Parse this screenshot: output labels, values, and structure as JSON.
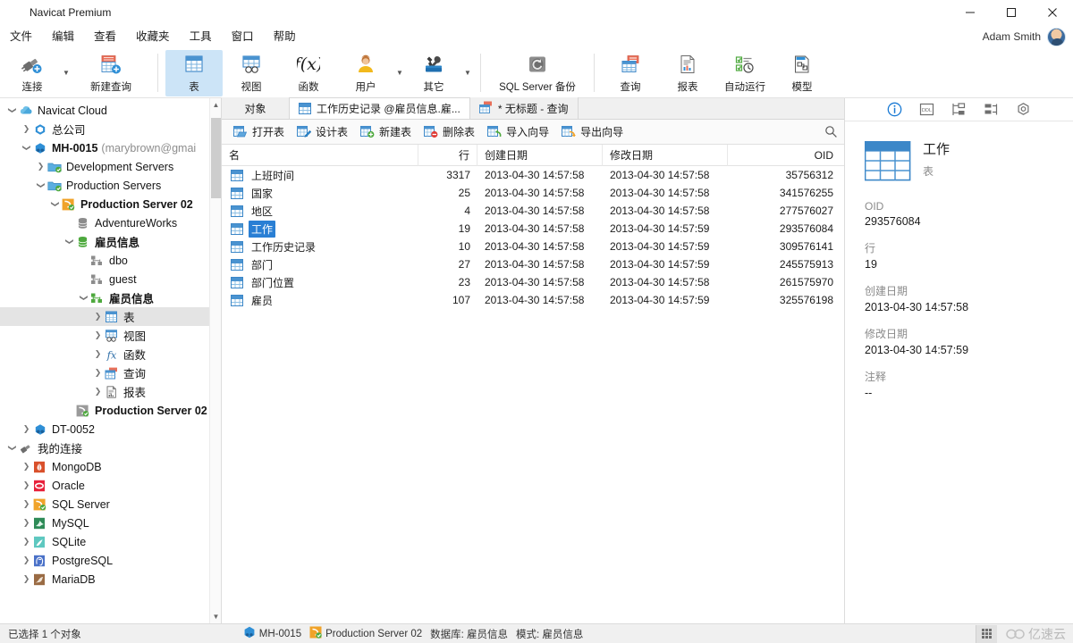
{
  "window": {
    "title": "Navicat Premium",
    "minimize": "—",
    "maximize": "□",
    "close": "✕"
  },
  "menu": {
    "items": [
      "文件",
      "编辑",
      "查看",
      "收藏夹",
      "工具",
      "窗口",
      "帮助"
    ],
    "user": "Adam Smith"
  },
  "toolbar": {
    "groups": [
      {
        "buttons": [
          {
            "label": "连接",
            "icon": "connection-icon",
            "caret": true,
            "selected": false
          },
          {
            "label": "新建查询",
            "icon": "new-query-icon",
            "caret": false,
            "selected": false
          }
        ]
      },
      {
        "buttons": [
          {
            "label": "表",
            "icon": "table-icon",
            "caret": false,
            "selected": true
          },
          {
            "label": "视图",
            "icon": "view-icon",
            "caret": false,
            "selected": false
          },
          {
            "label": "函数",
            "icon": "function-icon",
            "caret": false,
            "selected": false
          },
          {
            "label": "用户",
            "icon": "user-icon",
            "caret": true,
            "selected": false
          },
          {
            "label": "其它",
            "icon": "others-icon",
            "caret": true,
            "selected": false
          }
        ]
      },
      {
        "buttons": [
          {
            "label": "SQL Server 备份",
            "icon": "backup-icon",
            "caret": false,
            "selected": false
          }
        ]
      },
      {
        "buttons": [
          {
            "label": "查询",
            "icon": "query-icon",
            "caret": false,
            "selected": false
          },
          {
            "label": "报表",
            "icon": "report-icon",
            "caret": false,
            "selected": false
          },
          {
            "label": "自动运行",
            "icon": "automation-icon",
            "caret": false,
            "selected": false
          },
          {
            "label": "模型",
            "icon": "model-icon",
            "caret": false,
            "selected": false
          }
        ]
      }
    ]
  },
  "sidebar": {
    "nodes": [
      {
        "label": "Navicat Cloud",
        "sub": "",
        "indent": 0,
        "chev": "down",
        "icon": "cloud-icon",
        "bold": false,
        "selected": false
      },
      {
        "label": "总公司",
        "sub": "",
        "indent": 1,
        "chev": "right",
        "icon": "org-icon",
        "bold": false,
        "selected": false
      },
      {
        "label": "MH-0015",
        "sub": "(marybrown@gmai",
        "indent": 1,
        "chev": "down",
        "icon": "project-icon",
        "bold": true,
        "selected": false
      },
      {
        "label": "Development Servers",
        "sub": "",
        "indent": 2,
        "chev": "right",
        "icon": "folder-icon",
        "bold": false,
        "selected": false
      },
      {
        "label": "Production Servers",
        "sub": "",
        "indent": 2,
        "chev": "down",
        "icon": "folder-icon",
        "bold": false,
        "selected": false
      },
      {
        "label": "Production Server 02",
        "sub": "",
        "indent": 3,
        "chev": "down",
        "icon": "sqlserver-icon",
        "bold": true,
        "selected": false
      },
      {
        "label": "AdventureWorks",
        "sub": "",
        "indent": 4,
        "chev": "none",
        "icon": "db-gray-icon",
        "bold": false,
        "selected": false
      },
      {
        "label": "雇员信息",
        "sub": "",
        "indent": 4,
        "chev": "down",
        "icon": "db-green-icon",
        "bold": true,
        "selected": false
      },
      {
        "label": "dbo",
        "sub": "",
        "indent": 5,
        "chev": "none",
        "icon": "schema-gray-icon",
        "bold": false,
        "selected": false
      },
      {
        "label": "guest",
        "sub": "",
        "indent": 5,
        "chev": "none",
        "icon": "schema-gray-icon",
        "bold": false,
        "selected": false
      },
      {
        "label": "雇员信息",
        "sub": "",
        "indent": 5,
        "chev": "down",
        "icon": "schema-green-icon",
        "bold": true,
        "selected": false
      },
      {
        "label": "表",
        "sub": "",
        "indent": 6,
        "chev": "right",
        "icon": "table-icon",
        "bold": false,
        "selected": true
      },
      {
        "label": "视图",
        "sub": "",
        "indent": 6,
        "chev": "right",
        "icon": "view-icon",
        "bold": false,
        "selected": false
      },
      {
        "label": "函数",
        "sub": "",
        "indent": 6,
        "chev": "right",
        "icon": "function-icon",
        "bold": false,
        "selected": false
      },
      {
        "label": "查询",
        "sub": "",
        "indent": 6,
        "chev": "right",
        "icon": "query-icon",
        "bold": false,
        "selected": false
      },
      {
        "label": "报表",
        "sub": "",
        "indent": 6,
        "chev": "right",
        "icon": "report-icon",
        "bold": false,
        "selected": false
      },
      {
        "label": "Production Server 02",
        "sub": "",
        "indent": 4,
        "chev": "none",
        "icon": "sqlserver-gray-icon",
        "bold": true,
        "selected": false
      },
      {
        "label": "DT-0052",
        "sub": "",
        "indent": 1,
        "chev": "right",
        "icon": "project-icon",
        "bold": false,
        "selected": false
      },
      {
        "label": "我的连接",
        "sub": "",
        "indent": 0,
        "chev": "down",
        "icon": "connection-icon",
        "bold": false,
        "selected": false
      },
      {
        "label": "MongoDB",
        "sub": "",
        "indent": 1,
        "chev": "right",
        "icon": "mongodb-icon",
        "bold": false,
        "selected": false
      },
      {
        "label": "Oracle",
        "sub": "",
        "indent": 1,
        "chev": "right",
        "icon": "oracle-icon",
        "bold": false,
        "selected": false
      },
      {
        "label": "SQL Server",
        "sub": "",
        "indent": 1,
        "chev": "right",
        "icon": "sqlserver-icon",
        "bold": false,
        "selected": false
      },
      {
        "label": "MySQL",
        "sub": "",
        "indent": 1,
        "chev": "right",
        "icon": "mysql-icon",
        "bold": false,
        "selected": false
      },
      {
        "label": "SQLite",
        "sub": "",
        "indent": 1,
        "chev": "right",
        "icon": "sqlite-icon",
        "bold": false,
        "selected": false
      },
      {
        "label": "PostgreSQL",
        "sub": "",
        "indent": 1,
        "chev": "right",
        "icon": "postgresql-icon",
        "bold": false,
        "selected": false
      },
      {
        "label": "MariaDB",
        "sub": "",
        "indent": 1,
        "chev": "right",
        "icon": "mariadb-icon",
        "bold": false,
        "selected": false
      }
    ]
  },
  "tabs": {
    "object_tab": "对象",
    "items": [
      {
        "label": "工作历史记录 @雇员信息.雇...",
        "icon": "table-icon",
        "active": true
      },
      {
        "label": "* 无标题 - 查询",
        "icon": "query-icon",
        "active": false
      }
    ]
  },
  "object_toolbar": {
    "buttons": [
      {
        "label": "打开表",
        "icon": "open-table-icon"
      },
      {
        "label": "设计表",
        "icon": "design-table-icon"
      },
      {
        "label": "新建表",
        "icon": "new-table-icon"
      },
      {
        "label": "删除表",
        "icon": "delete-table-icon"
      },
      {
        "label": "导入向导",
        "icon": "import-wizard-icon"
      },
      {
        "label": "导出向导",
        "icon": "export-wizard-icon"
      }
    ],
    "search_icon": "search-icon"
  },
  "grid": {
    "columns": [
      "名",
      "行",
      "创建日期",
      "修改日期",
      "OID"
    ],
    "rows": [
      {
        "name": "上班时间",
        "rows": "3317",
        "created": "2013-04-30 14:57:58",
        "modified": "2013-04-30 14:57:58",
        "oid": "35756312",
        "selected": false
      },
      {
        "name": "国家",
        "rows": "25",
        "created": "2013-04-30 14:57:58",
        "modified": "2013-04-30 14:57:58",
        "oid": "341576255",
        "selected": false
      },
      {
        "name": "地区",
        "rows": "4",
        "created": "2013-04-30 14:57:58",
        "modified": "2013-04-30 14:57:58",
        "oid": "277576027",
        "selected": false
      },
      {
        "name": "工作",
        "rows": "19",
        "created": "2013-04-30 14:57:58",
        "modified": "2013-04-30 14:57:59",
        "oid": "293576084",
        "selected": true
      },
      {
        "name": "工作历史记录",
        "rows": "10",
        "created": "2013-04-30 14:57:58",
        "modified": "2013-04-30 14:57:59",
        "oid": "309576141",
        "selected": false
      },
      {
        "name": "部门",
        "rows": "27",
        "created": "2013-04-30 14:57:58",
        "modified": "2013-04-30 14:57:59",
        "oid": "245575913",
        "selected": false
      },
      {
        "name": "部门位置",
        "rows": "23",
        "created": "2013-04-30 14:57:58",
        "modified": "2013-04-30 14:57:58",
        "oid": "261575970",
        "selected": false
      },
      {
        "name": "雇员",
        "rows": "107",
        "created": "2013-04-30 14:57:58",
        "modified": "2013-04-30 14:57:59",
        "oid": "325576198",
        "selected": false
      }
    ]
  },
  "info_panel": {
    "tabs": [
      {
        "icon": "info-icon",
        "active": true
      },
      {
        "icon": "ddl-icon",
        "active": false
      },
      {
        "icon": "structure-icon",
        "active": false
      },
      {
        "icon": "relations-icon",
        "active": false
      },
      {
        "icon": "settings-icon",
        "active": false
      }
    ],
    "title": "工作",
    "subtitle": "表",
    "fields": [
      {
        "label": "OID",
        "value": "293576084"
      },
      {
        "label": "行",
        "value": "19"
      },
      {
        "label": "创建日期",
        "value": "2013-04-30 14:57:58"
      },
      {
        "label": "修改日期",
        "value": "2013-04-30 14:57:59"
      },
      {
        "label": "注释",
        "value": "--"
      }
    ]
  },
  "status": {
    "selection": "已选择 1 个对象",
    "connection": "MH-0015",
    "server": "Production Server 02",
    "database": "数据库: 雇员信息",
    "schema": "模式: 雇员信息",
    "watermark": "亿速云"
  },
  "colors": {
    "accent": "#2a7fd4",
    "selected_toolbar": "#cce4f7",
    "tree_selection": "#e4e4e4",
    "chrome": "#f0f0f0"
  }
}
